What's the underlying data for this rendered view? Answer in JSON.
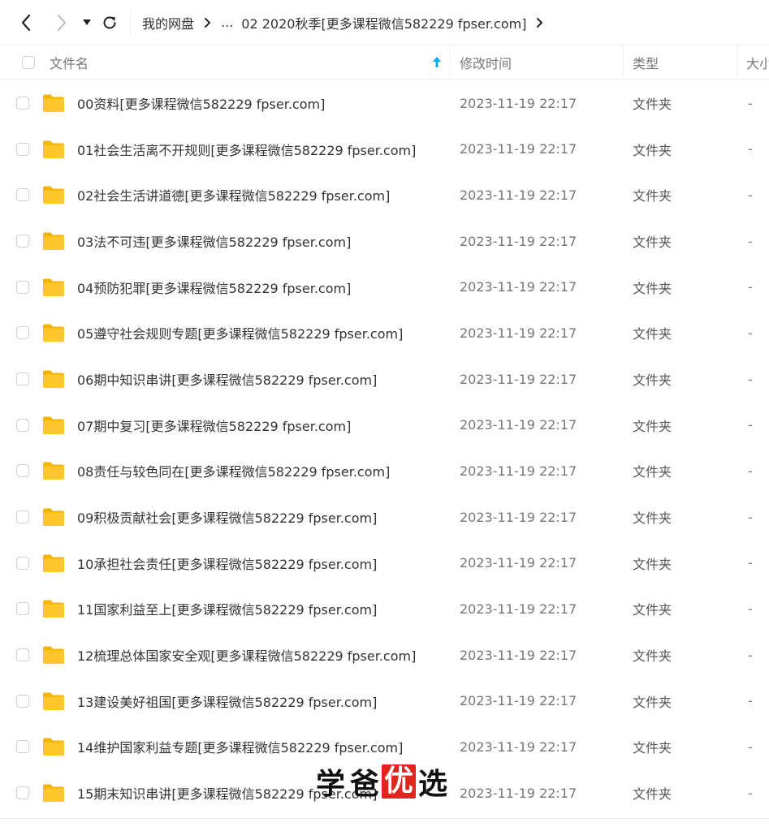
{
  "breadcrumb": {
    "root": "我的网盘",
    "ellipsis": "...",
    "current": "02 2020秋季[更多课程微信582229 fpser.com]"
  },
  "columns": {
    "name": "文件名",
    "modified": "修改时间",
    "type": "类型",
    "size": "大小"
  },
  "files": [
    {
      "name": "00资料[更多课程微信582229 fpser.com]",
      "modified": "2023-11-19 22:17",
      "type": "文件夹",
      "size": "-"
    },
    {
      "name": "01社会生活离不开规则[更多课程微信582229 fpser.com]",
      "modified": "2023-11-19 22:17",
      "type": "文件夹",
      "size": "-"
    },
    {
      "name": "02社会生活讲道德[更多课程微信582229 fpser.com]",
      "modified": "2023-11-19 22:17",
      "type": "文件夹",
      "size": "-"
    },
    {
      "name": "03法不可违[更多课程微信582229 fpser.com]",
      "modified": "2023-11-19 22:17",
      "type": "文件夹",
      "size": "-"
    },
    {
      "name": "04预防犯罪[更多课程微信582229 fpser.com]",
      "modified": "2023-11-19 22:17",
      "type": "文件夹",
      "size": "-"
    },
    {
      "name": "05遵守社会规则专题[更多课程微信582229 fpser.com]",
      "modified": "2023-11-19 22:17",
      "type": "文件夹",
      "size": "-"
    },
    {
      "name": "06期中知识串讲[更多课程微信582229 fpser.com]",
      "modified": "2023-11-19 22:17",
      "type": "文件夹",
      "size": "-"
    },
    {
      "name": "07期中复习[更多课程微信582229 fpser.com]",
      "modified": "2023-11-19 22:17",
      "type": "文件夹",
      "size": "-"
    },
    {
      "name": "08责任与较色同在[更多课程微信582229 fpser.com]",
      "modified": "2023-11-19 22:17",
      "type": "文件夹",
      "size": "-"
    },
    {
      "name": "09积极贡献社会[更多课程微信582229 fpser.com]",
      "modified": "2023-11-19 22:17",
      "type": "文件夹",
      "size": "-"
    },
    {
      "name": "10承担社会责任[更多课程微信582229 fpser.com]",
      "modified": "2023-11-19 22:17",
      "type": "文件夹",
      "size": "-"
    },
    {
      "name": "11国家利益至上[更多课程微信582229 fpser.com]",
      "modified": "2023-11-19 22:17",
      "type": "文件夹",
      "size": "-"
    },
    {
      "name": "12梳理总体国家安全观[更多课程微信582229 fpser.com]",
      "modified": "2023-11-19 22:17",
      "type": "文件夹",
      "size": "-"
    },
    {
      "name": "13建设美好祖国[更多课程微信582229 fpser.com]",
      "modified": "2023-11-19 22:17",
      "type": "文件夹",
      "size": "-"
    },
    {
      "name": "14维护国家利益专题[更多课程微信582229 fpser.com]",
      "modified": "2023-11-19 22:17",
      "type": "文件夹",
      "size": "-"
    },
    {
      "name": "15期末知识串讲[更多课程微信582229 fpser.com]",
      "modified": "2023-11-19 22:17",
      "type": "文件夹",
      "size": "-"
    }
  ],
  "watermark": {
    "c1": "学",
    "c2": "爸",
    "c3": "优",
    "c4": "选"
  },
  "colors": {
    "folder": "#FFC72C",
    "accent": "#06A7FF",
    "watermark_red": "#E0261C"
  },
  "icons": {
    "back": "chevron-left-icon",
    "forward": "chevron-right-icon",
    "dropdown": "caret-down-icon",
    "refresh": "refresh-icon",
    "sort": "sort-up-arrow-icon",
    "folder": "folder-icon"
  }
}
